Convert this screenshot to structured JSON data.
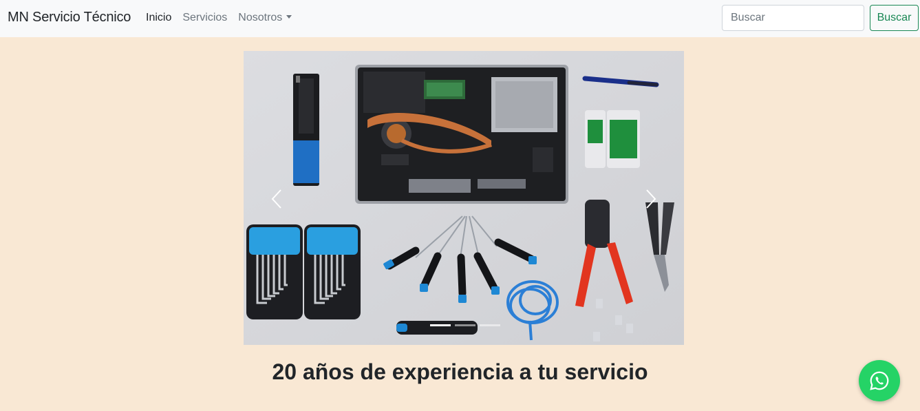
{
  "navbar": {
    "brand": "MN Servicio Técnico",
    "links": [
      {
        "label": "Inicio",
        "active": true
      },
      {
        "label": "Servicios",
        "active": false
      },
      {
        "label": "Nosotros",
        "dropdown": true
      }
    ],
    "search": {
      "placeholder": "Buscar",
      "button_label": "Buscar"
    }
  },
  "carousel": {
    "slide_count": 3,
    "active_slide": 1,
    "image": "laptop-repair-tools-photo",
    "prev_icon": "chevron-left-icon",
    "next_icon": "chevron-right-icon"
  },
  "main": {
    "headline": "20 años de experiencia a tu servicio"
  },
  "floating": {
    "whatsapp_icon": "whatsapp-icon"
  },
  "colors": {
    "page_bg": "#f9e8d4",
    "navbar_bg": "#f8f9fa",
    "success": "#198754",
    "whatsapp": "#25d366"
  }
}
